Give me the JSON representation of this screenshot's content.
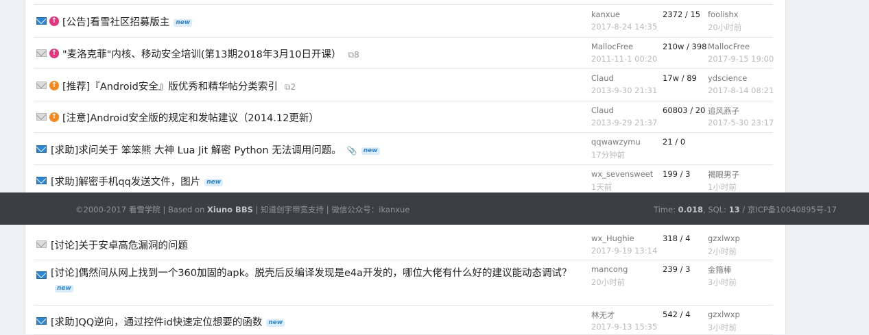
{
  "threads_top": [
    {
      "env": "blue",
      "arrow": "pink",
      "title": "[公告]看雪社区招募版主",
      "badge": "new",
      "replies_icon": "",
      "replies": "",
      "attach": false,
      "author": "kanxue",
      "created": "2017-8-24 14:35",
      "stats": "2372 / 15",
      "last_user": "foolishx",
      "last_time": "20小时前"
    },
    {
      "env": "gray",
      "arrow": "pink",
      "title": "\"麦洛克菲\"内核、移动安全培训(第13期2018年3月10日开课）",
      "badge": "",
      "replies_icon": "⧉",
      "replies": "8",
      "attach": false,
      "author": "MallocFree",
      "created": "2011-11-1 00:20",
      "stats": "210w / 398",
      "last_user": "MallocFree",
      "last_time": "2017-9-15 19:00"
    },
    {
      "env": "gray",
      "arrow": "orange",
      "title": "[推荐]『Android安全』版优秀和精华帖分类索引",
      "badge": "",
      "replies_icon": "⧉",
      "replies": "2",
      "attach": false,
      "author": "Claud",
      "created": "2013-9-30 21:31",
      "stats": "17w / 89",
      "last_user": "ydscience",
      "last_time": "2017-8-14 08:21"
    },
    {
      "env": "gray",
      "arrow": "orange",
      "title": "[注意]Android安全版的规定和发帖建议（2014.12更新）",
      "badge": "",
      "replies_icon": "",
      "replies": "",
      "attach": false,
      "author": "Claud",
      "created": "2013-9-29 21:37",
      "stats": "60803 / 20",
      "last_user": "追风燕子",
      "last_time": "2017-5-30 23:17"
    },
    {
      "env": "blue",
      "arrow": "",
      "title": "[求助]求问关于 笨笨熊 大神 Lua Jit 解密 Python 无法调用问题。",
      "badge": "new",
      "replies_icon": "",
      "replies": "",
      "attach": true,
      "author": "qqwawzymu",
      "created": "17分钟前",
      "stats": "21 / 0",
      "last_user": "",
      "last_time": ""
    },
    {
      "env": "blue",
      "arrow": "",
      "title": "[求助]解密手机qq发送文件，图片",
      "badge": "new",
      "replies_icon": "",
      "replies": "",
      "attach": false,
      "author": "wx_sevensweet",
      "created": "1天前",
      "stats": "199 / 3",
      "last_user": "褐眼男子",
      "last_time": "1小时前"
    }
  ],
  "threads_bottom": [
    {
      "env": "gray",
      "title": "[讨论]关于安卓高危漏洞的问题",
      "badge": "",
      "author": "wx_Hughie",
      "created": "2017-9-19 13:14",
      "stats": "318 / 4",
      "last_user": "gzxlwxp",
      "last_time": "2小时前"
    },
    {
      "env": "blue",
      "title": "[讨论]偶然间从网上找到一个360加固的apk。脱壳后反编译发现是e4a开发的，哪位大佬有什么好的建议能动态调试？",
      "badge": "new",
      "author": "mancong",
      "created": "20小时前",
      "stats": "239 / 3",
      "last_user": "金箍棒",
      "last_time": "3小时前"
    },
    {
      "env": "blue",
      "title": "[求助]QQ逆向，通过控件id快速定位想要的函数",
      "badge": "new",
      "author": "林无才",
      "created": "2017-9-13 15:35",
      "stats": "542 / 4",
      "last_user": "gzxlwxp",
      "last_time": "3小时前"
    }
  ],
  "footer": {
    "copyright": "©2000-2017 看雪学院 | Based on ",
    "engine": "Xiuno BBS",
    "rest": " | 知道创宇带宽支持 | 微信公众号：ikanxue",
    "time_label": "Time: ",
    "time_value": "0.018",
    "sql_label": ", SQL: ",
    "sql_value": "13",
    "icp": " / 京ICP备10040895号-17"
  }
}
